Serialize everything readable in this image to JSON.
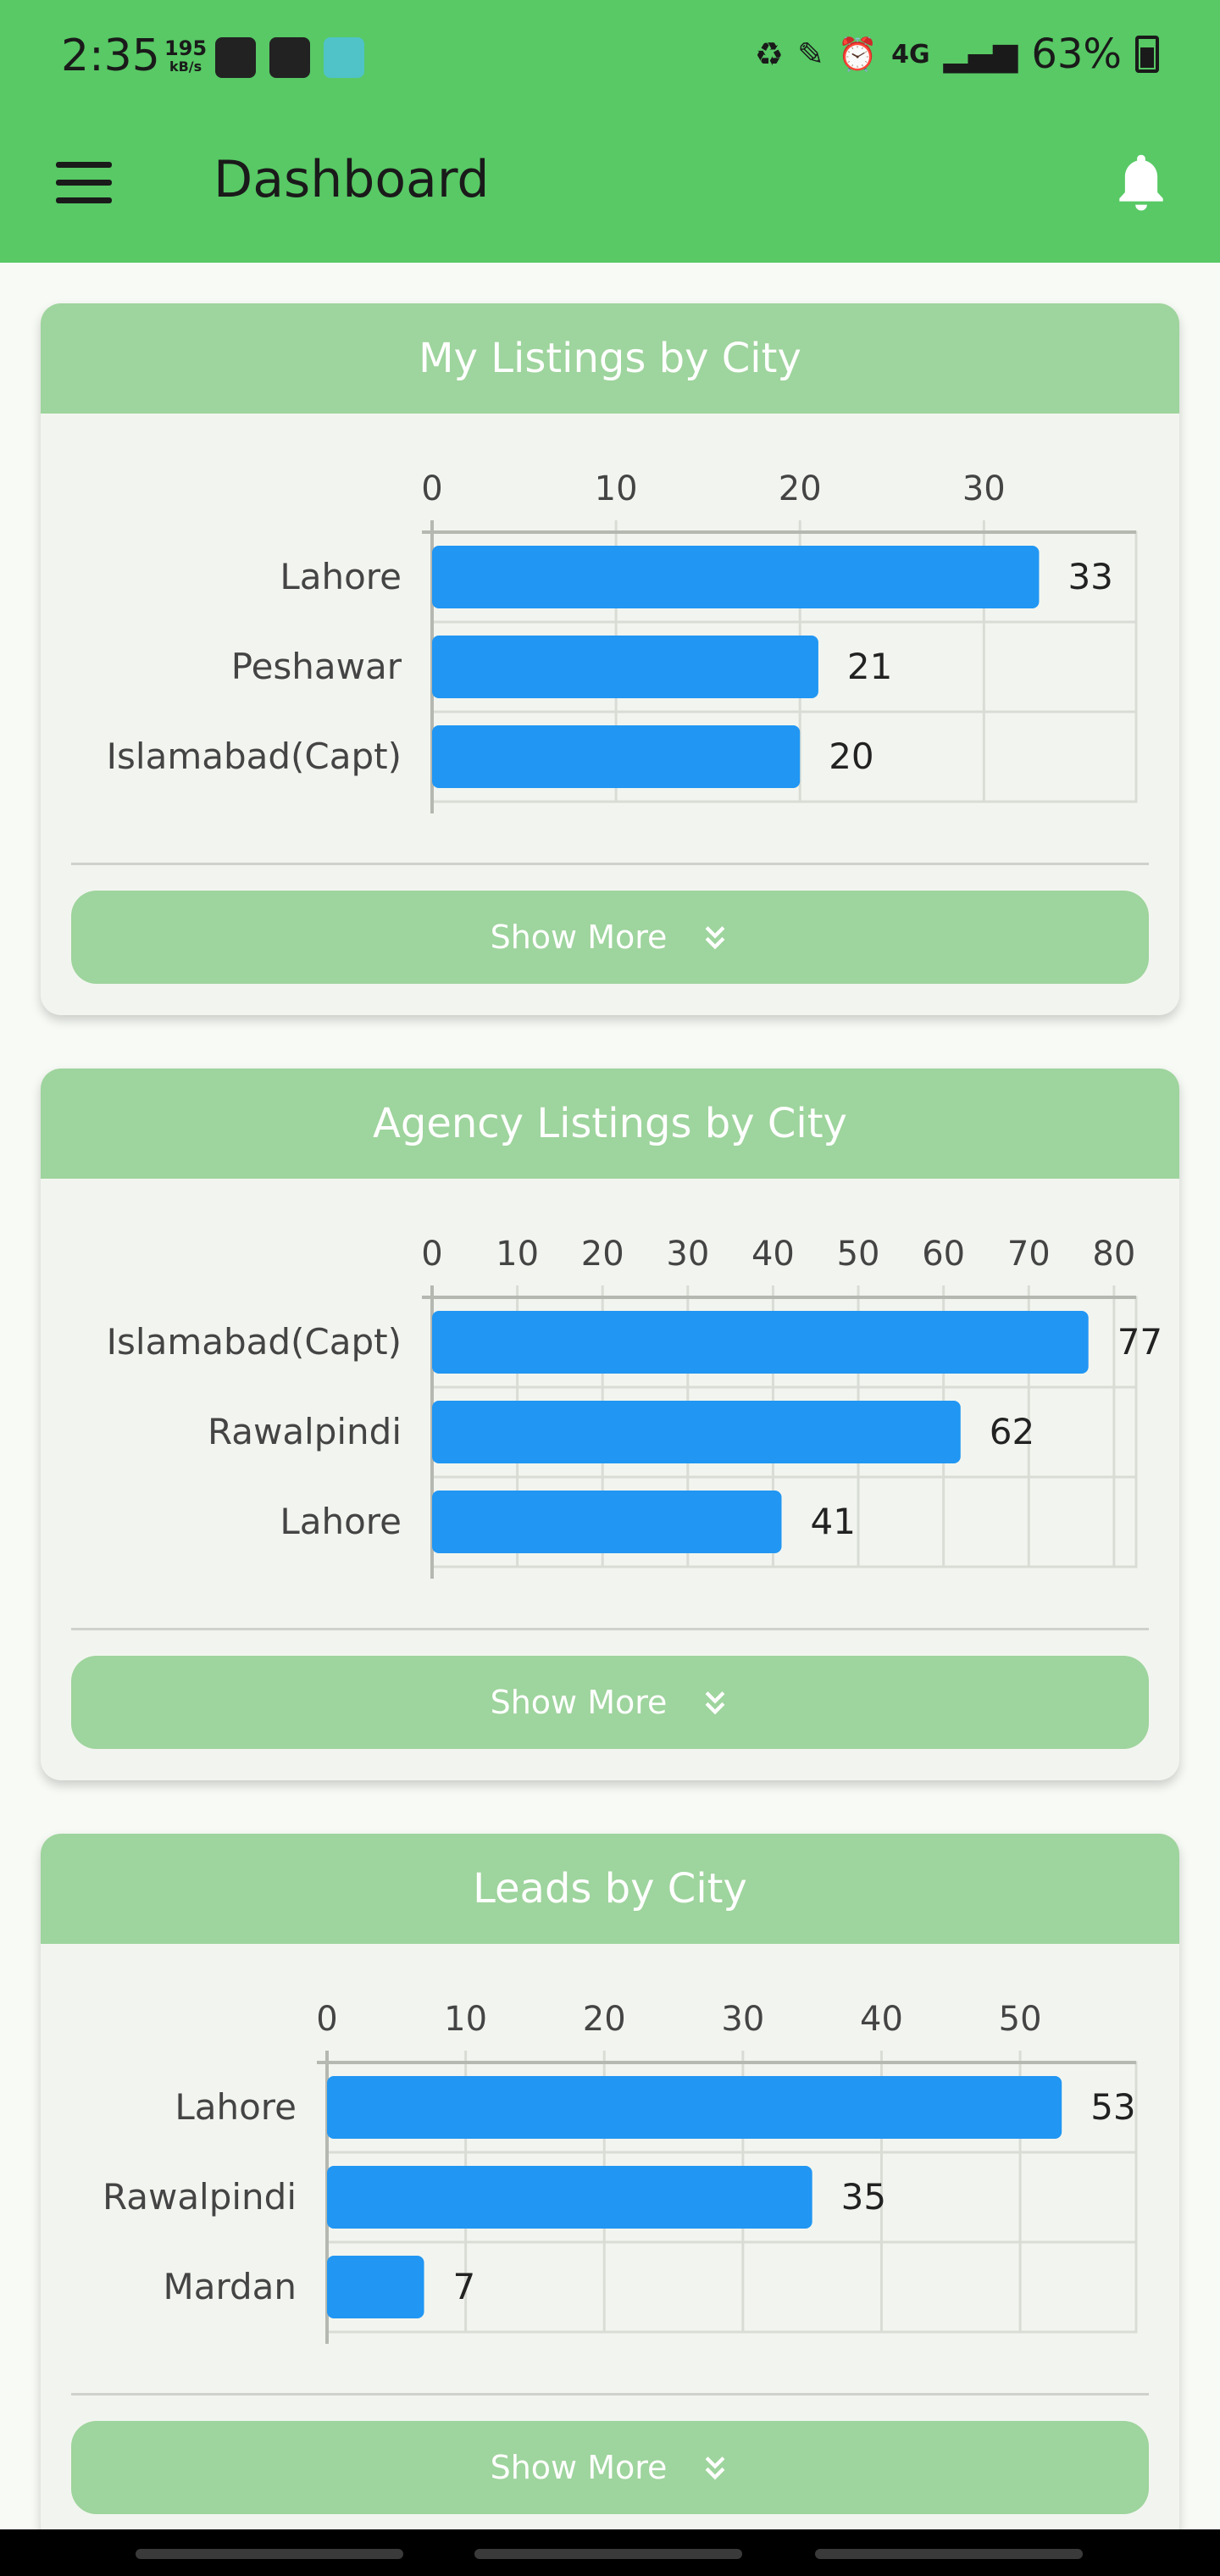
{
  "status_bar": {
    "time": "2:35",
    "net_speed": "195",
    "net_unit": "kB/s",
    "network": "4G",
    "battery": "63%"
  },
  "app_bar": {
    "title": "Dashboard",
    "menu_icon": "hamburger-menu-icon",
    "bell_icon": "notification-bell-icon"
  },
  "colors": {
    "primary_green": "#58c965",
    "header_green": "#9ed49d",
    "bar_blue": "#2196f3",
    "card_bg": "#f2f5ef"
  },
  "cards": [
    {
      "title": "My Listings by City",
      "show_more_label": "Show More"
    },
    {
      "title": "Agency Listings by City",
      "show_more_label": "Show More"
    },
    {
      "title": "Leads by City",
      "show_more_label": "Show More"
    }
  ],
  "chart_data": [
    {
      "type": "bar",
      "orientation": "horizontal",
      "title": "My Listings by City",
      "categories": [
        "Lahore",
        "Peshawar",
        "Islamabad(Capt)"
      ],
      "values": [
        33,
        21,
        20
      ],
      "xlim": [
        0,
        38
      ],
      "ticks": [
        0,
        10,
        20,
        30
      ],
      "grid": true
    },
    {
      "type": "bar",
      "orientation": "horizontal",
      "title": "Agency Listings by City",
      "categories": [
        "Islamabad(Capt)",
        "Rawalpindi",
        "Lahore"
      ],
      "values": [
        77,
        62,
        41
      ],
      "xlim": [
        0,
        82
      ],
      "ticks": [
        0,
        10,
        20,
        30,
        40,
        50,
        60,
        70,
        80
      ],
      "grid": true
    },
    {
      "type": "bar",
      "orientation": "horizontal",
      "title": "Leads by City",
      "categories": [
        "Lahore",
        "Rawalpindi",
        "Mardan"
      ],
      "values": [
        53,
        35,
        7
      ],
      "xlim": [
        0,
        58
      ],
      "ticks": [
        0,
        10,
        20,
        30,
        40,
        50
      ],
      "grid": true
    }
  ]
}
